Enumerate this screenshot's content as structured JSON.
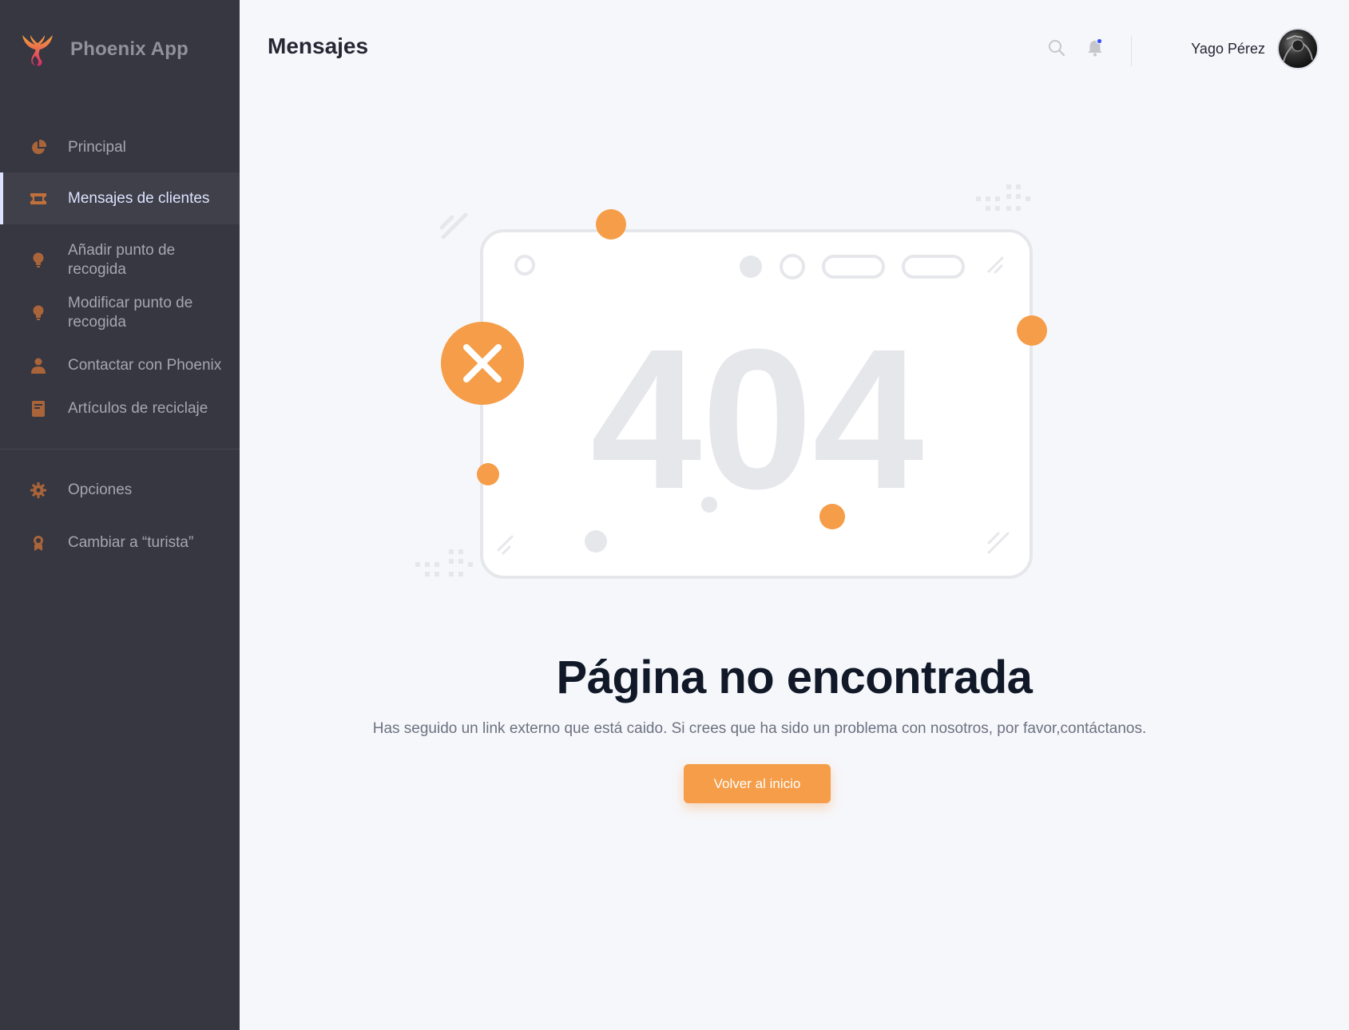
{
  "app": {
    "name": "Phoenix App",
    "accent": "#f59d48",
    "sidebar_bg": "#363740"
  },
  "sidebar": {
    "items": [
      {
        "label": "Principal",
        "icon": "pie-chart-icon"
      },
      {
        "label": "Mensajes de clientes",
        "icon": "ticket-icon",
        "active": true
      },
      {
        "label": "Añadir punto de recogida",
        "icon": "lightbulb-icon"
      },
      {
        "label": "Modificar punto de recogida",
        "icon": "lightbulb-icon"
      },
      {
        "label": "Contactar con Phoenix",
        "icon": "user-icon"
      },
      {
        "label": "Artículos de reciclaje",
        "icon": "book-icon"
      }
    ],
    "bottom_items": [
      {
        "label": "Opciones",
        "icon": "gear-icon"
      },
      {
        "label": "Cambiar a “turista”",
        "icon": "award-icon"
      }
    ]
  },
  "header": {
    "title": "Mensajes",
    "user_name": "Yago Pérez"
  },
  "error": {
    "code": "404",
    "title": "Página no encontrada",
    "message": "Has seguido un link externo que está caido. Si crees que ha sido un problema con nosotros, por favor,contáctanos.",
    "button_label": "Volver al inicio"
  }
}
